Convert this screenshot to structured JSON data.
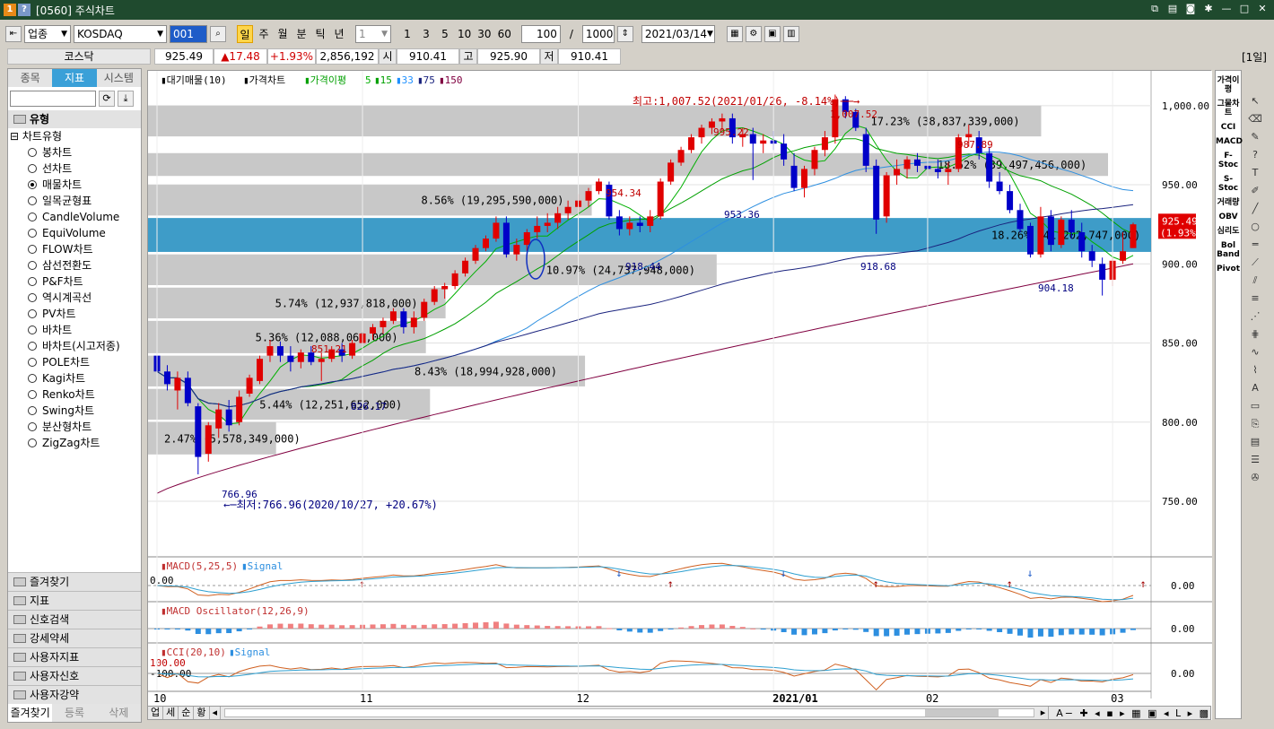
{
  "window": {
    "title": "[0560] 주식차트",
    "badge_a": "1",
    "badge_b": "?"
  },
  "toolbar": {
    "market_type": "업종",
    "market_name": "KOSDAQ",
    "code": "001",
    "periods": [
      "일",
      "주",
      "월",
      "분",
      "틱",
      "년"
    ],
    "active_period": "일",
    "interval": "1",
    "quick_counts": [
      "1",
      "3",
      "5",
      "10",
      "30",
      "60"
    ],
    "display_count": "100",
    "slash": "/",
    "total_count": "1000",
    "date": "2021/03/14"
  },
  "pricebar": {
    "name": "코스닥",
    "close": "925.49",
    "change": "▲17.48",
    "change_pct": "+1.93%",
    "volume": "2,856,192",
    "open_label": "시",
    "open": "910.41",
    "high_label": "고",
    "high": "925.90",
    "low_label": "저",
    "low": "910.41",
    "period_badge": "[1일]"
  },
  "left_panel": {
    "tabs": [
      "종목",
      "지표",
      "시스템"
    ],
    "active_tab": "지표",
    "category": "유형",
    "subcategory": "차트유형",
    "options": [
      "봉차트",
      "선차트",
      "매물차트",
      "일목균형표",
      "CandleVolume",
      "EquiVolume",
      "FLOW차트",
      "삼선전환도",
      "P&F차트",
      "역시계곡선",
      "PV차트",
      "바차트",
      "바차트(시고저종)",
      "POLE차트",
      "Kagi차트",
      "Renko차트",
      "Swing차트",
      "분산형차트",
      "ZigZag차트"
    ],
    "selected_option": "매물차트",
    "bottom_categories": [
      "즐겨찾기",
      "지표",
      "신호검색",
      "강세약세",
      "사용자지표",
      "사용자신호",
      "사용자강약"
    ],
    "bottom_tabs": [
      "즐겨찾기",
      "등록",
      "삭제"
    ]
  },
  "right_panel": {
    "items": [
      "가격이평",
      "그물차트",
      "CCI",
      "MACD",
      "F-Stoc",
      "S-Stoc",
      "거래량",
      "OBV",
      "심리도",
      "Bol Band",
      "Pivot"
    ]
  },
  "scrollbar": {
    "tabs": [
      "업",
      "세",
      "순",
      "황"
    ]
  },
  "chart_data": {
    "type": "candlestick",
    "legend": [
      "대기매물(10)",
      "가격차트",
      "가격이평",
      "5",
      "15",
      "33",
      "75",
      "150"
    ],
    "legend_colors": [
      "#000000",
      "#000000",
      "#00a000",
      "#00c000",
      "#00a000",
      "#1e90ff",
      "#1a237e",
      "#800040"
    ],
    "y_ticks": [
      1000,
      950,
      900,
      850,
      800,
      750
    ],
    "y_tick_labels": [
      "1,000.00",
      "950.00",
      "900.00",
      "850.00",
      "800.00",
      "750.00"
    ],
    "ylim": [
      716,
      1022
    ],
    "x_labels": [
      "10",
      "11",
      "12",
      "2021/01",
      "02",
      "03"
    ],
    "current_price": "925.49",
    "current_change": "(1.93%)",
    "annotations": {
      "high": "최고:1,007.52(2021/01/26, -8.14%)",
      "low": "최저:766.96(2020/10/27, +20.67%)",
      "points": [
        {
          "text": "1,007.52",
          "color": "#c00000"
        },
        {
          "text": "995.22",
          "color": "#c00000"
        },
        {
          "text": "987.89",
          "color": "#c00000"
        },
        {
          "text": "954.34",
          "color": "#c00000"
        },
        {
          "text": "851.21",
          "color": "#c00000"
        },
        {
          "text": "953.36",
          "color": "#000080"
        },
        {
          "text": "918.44",
          "color": "#000080"
        },
        {
          "text": "918.68",
          "color": "#000080"
        },
        {
          "text": "904.18",
          "color": "#000080"
        },
        {
          "text": "826.17",
          "color": "#000080"
        },
        {
          "text": "766.96",
          "color": "#000080"
        }
      ]
    },
    "volume_profile": [
      {
        "label": "17.23% (38,837,339,000)",
        "low": 980,
        "high": 1000
      },
      {
        "label": "18.52% (39,497,456,000)",
        "low": 955,
        "high": 970
      },
      {
        "label": "8.56% (19,295,590,000)",
        "low": 930,
        "high": 950
      },
      {
        "label": "18.26% (41,202,747,000)",
        "low": 907,
        "high": 929
      },
      {
        "label": "10.97% (24,737,948,000)",
        "low": 886,
        "high": 906
      },
      {
        "label": "5.74% (12,937,818,000)",
        "low": 865,
        "high": 885
      },
      {
        "label": "5.36% (12,088,068,000)",
        "low": 843,
        "high": 864
      },
      {
        "label": "8.43% (18,994,928,000)",
        "low": 822,
        "high": 842
      },
      {
        "label": "5.44% (12,251,652,000)",
        "low": 801,
        "high": 821
      },
      {
        "label": "2.47% (5,578,349,000)",
        "low": 779,
        "high": 800
      }
    ],
    "candles": [
      {
        "d": "2020-10-21",
        "o": 842,
        "h": 845,
        "l": 830,
        "c": 832
      },
      {
        "d": "2020-10-22",
        "o": 832,
        "h": 836,
        "l": 820,
        "c": 824
      },
      {
        "d": "2020-10-23",
        "o": 820,
        "h": 832,
        "l": 808,
        "c": 828
      },
      {
        "d": "2020-10-26",
        "o": 828,
        "h": 832,
        "l": 810,
        "c": 812
      },
      {
        "d": "2020-10-27",
        "o": 810,
        "h": 812,
        "l": 767,
        "c": 778
      },
      {
        "d": "2020-10-28",
        "o": 780,
        "h": 800,
        "l": 775,
        "c": 798
      },
      {
        "d": "2020-10-29",
        "o": 796,
        "h": 812,
        "l": 790,
        "c": 808
      },
      {
        "d": "2020-10-30",
        "o": 808,
        "h": 814,
        "l": 794,
        "c": 798
      },
      {
        "d": "2020-11-02",
        "o": 800,
        "h": 820,
        "l": 798,
        "c": 816
      },
      {
        "d": "2020-11-03",
        "o": 818,
        "h": 830,
        "l": 816,
        "c": 828
      },
      {
        "d": "2020-11-04",
        "o": 826,
        "h": 842,
        "l": 824,
        "c": 840
      },
      {
        "d": "2020-11-05",
        "o": 842,
        "h": 852,
        "l": 838,
        "c": 848
      },
      {
        "d": "2020-11-06",
        "o": 848,
        "h": 851,
        "l": 838,
        "c": 842
      },
      {
        "d": "2020-11-09",
        "o": 842,
        "h": 848,
        "l": 832,
        "c": 838
      },
      {
        "d": "2020-11-10",
        "o": 838,
        "h": 846,
        "l": 834,
        "c": 844
      },
      {
        "d": "2020-11-11",
        "o": 844,
        "h": 848,
        "l": 836,
        "c": 838
      },
      {
        "d": "2020-11-12",
        "o": 838,
        "h": 844,
        "l": 826,
        "c": 840
      },
      {
        "d": "2020-11-13",
        "o": 840,
        "h": 848,
        "l": 838,
        "c": 846
      },
      {
        "d": "2020-11-16",
        "o": 846,
        "h": 850,
        "l": 838,
        "c": 842
      },
      {
        "d": "2020-11-17",
        "o": 842,
        "h": 852,
        "l": 840,
        "c": 850
      },
      {
        "d": "2020-11-18",
        "o": 850,
        "h": 858,
        "l": 848,
        "c": 856
      },
      {
        "d": "2020-11-19",
        "o": 856,
        "h": 862,
        "l": 852,
        "c": 860
      },
      {
        "d": "2020-11-20",
        "o": 860,
        "h": 866,
        "l": 856,
        "c": 864
      },
      {
        "d": "2020-11-23",
        "o": 864,
        "h": 872,
        "l": 862,
        "c": 870
      },
      {
        "d": "2020-11-24",
        "o": 870,
        "h": 872,
        "l": 856,
        "c": 860
      },
      {
        "d": "2020-11-25",
        "o": 860,
        "h": 870,
        "l": 856,
        "c": 866
      },
      {
        "d": "2020-11-26",
        "o": 866,
        "h": 878,
        "l": 864,
        "c": 876
      },
      {
        "d": "2020-11-27",
        "o": 876,
        "h": 886,
        "l": 874,
        "c": 884
      },
      {
        "d": "2020-11-30",
        "o": 884,
        "h": 888,
        "l": 878,
        "c": 886
      },
      {
        "d": "2020-12-01",
        "o": 886,
        "h": 896,
        "l": 884,
        "c": 894
      },
      {
        "d": "2020-12-02",
        "o": 894,
        "h": 904,
        "l": 892,
        "c": 902
      },
      {
        "d": "2020-12-03",
        "o": 902,
        "h": 912,
        "l": 900,
        "c": 910
      },
      {
        "d": "2020-12-04",
        "o": 910,
        "h": 918,
        "l": 908,
        "c": 916
      },
      {
        "d": "2020-12-07",
        "o": 916,
        "h": 930,
        "l": 914,
        "c": 926
      },
      {
        "d": "2020-12-08",
        "o": 926,
        "h": 930,
        "l": 904,
        "c": 906
      },
      {
        "d": "2020-12-09",
        "o": 906,
        "h": 916,
        "l": 902,
        "c": 912
      },
      {
        "d": "2020-12-10",
        "o": 912,
        "h": 922,
        "l": 908,
        "c": 920
      },
      {
        "d": "2020-12-11",
        "o": 920,
        "h": 930,
        "l": 916,
        "c": 924
      },
      {
        "d": "2020-12-14",
        "o": 924,
        "h": 932,
        "l": 920,
        "c": 926
      },
      {
        "d": "2020-12-15",
        "o": 926,
        "h": 936,
        "l": 922,
        "c": 932
      },
      {
        "d": "2020-12-16",
        "o": 932,
        "h": 940,
        "l": 928,
        "c": 936
      },
      {
        "d": "2020-12-17",
        "o": 936,
        "h": 944,
        "l": 932,
        "c": 940
      },
      {
        "d": "2020-12-18",
        "o": 940,
        "h": 948,
        "l": 936,
        "c": 946
      },
      {
        "d": "2020-12-21",
        "o": 946,
        "h": 954,
        "l": 944,
        "c": 952
      },
      {
        "d": "2020-12-22",
        "o": 950,
        "h": 952,
        "l": 928,
        "c": 930
      },
      {
        "d": "2020-12-23",
        "o": 930,
        "h": 934,
        "l": 918,
        "c": 922
      },
      {
        "d": "2020-12-24",
        "o": 922,
        "h": 930,
        "l": 918,
        "c": 926
      },
      {
        "d": "2020-12-28",
        "o": 926,
        "h": 930,
        "l": 920,
        "c": 924
      },
      {
        "d": "2020-12-29",
        "o": 924,
        "h": 934,
        "l": 920,
        "c": 930
      },
      {
        "d": "2020-12-30",
        "o": 930,
        "h": 954,
        "l": 928,
        "c": 952
      },
      {
        "d": "2021-01-04",
        "o": 952,
        "h": 966,
        "l": 950,
        "c": 964
      },
      {
        "d": "2021-01-05",
        "o": 964,
        "h": 974,
        "l": 962,
        "c": 972
      },
      {
        "d": "2021-01-06",
        "o": 972,
        "h": 982,
        "l": 970,
        "c": 980
      },
      {
        "d": "2021-01-07",
        "o": 980,
        "h": 988,
        "l": 976,
        "c": 986
      },
      {
        "d": "2021-01-08",
        "o": 986,
        "h": 992,
        "l": 982,
        "c": 990
      },
      {
        "d": "2021-01-11",
        "o": 990,
        "h": 995,
        "l": 984,
        "c": 992
      },
      {
        "d": "2021-01-12",
        "o": 992,
        "h": 995,
        "l": 976,
        "c": 980
      },
      {
        "d": "2021-01-13",
        "o": 980,
        "h": 986,
        "l": 974,
        "c": 982
      },
      {
        "d": "2021-01-14",
        "o": 982,
        "h": 986,
        "l": 953,
        "c": 976
      },
      {
        "d": "2021-01-15",
        "o": 976,
        "h": 982,
        "l": 970,
        "c": 978
      },
      {
        "d": "2021-01-18",
        "o": 978,
        "h": 984,
        "l": 972,
        "c": 976
      },
      {
        "d": "2021-01-19",
        "o": 976,
        "h": 982,
        "l": 962,
        "c": 966
      },
      {
        "d": "2021-01-20",
        "o": 962,
        "h": 970,
        "l": 946,
        "c": 948
      },
      {
        "d": "2021-01-21",
        "o": 948,
        "h": 962,
        "l": 942,
        "c": 960
      },
      {
        "d": "2021-01-22",
        "o": 960,
        "h": 974,
        "l": 956,
        "c": 972
      },
      {
        "d": "2021-01-25",
        "o": 972,
        "h": 984,
        "l": 968,
        "c": 980
      },
      {
        "d": "2021-01-26",
        "o": 980,
        "h": 1007,
        "l": 976,
        "c": 1004
      },
      {
        "d": "2021-01-27",
        "o": 1004,
        "h": 1006,
        "l": 992,
        "c": 996
      },
      {
        "d": "2021-01-28",
        "o": 996,
        "h": 998,
        "l": 984,
        "c": 986
      },
      {
        "d": "2021-01-29",
        "o": 982,
        "h": 986,
        "l": 958,
        "c": 962
      },
      {
        "d": "2021-02-01",
        "o": 962,
        "h": 966,
        "l": 919,
        "c": 928
      },
      {
        "d": "2021-02-02",
        "o": 930,
        "h": 958,
        "l": 926,
        "c": 956
      },
      {
        "d": "2021-02-03",
        "o": 956,
        "h": 966,
        "l": 950,
        "c": 960
      },
      {
        "d": "2021-02-04",
        "o": 960,
        "h": 968,
        "l": 954,
        "c": 966
      },
      {
        "d": "2021-02-05",
        "o": 966,
        "h": 970,
        "l": 958,
        "c": 962
      },
      {
        "d": "2021-02-08",
        "o": 962,
        "h": 968,
        "l": 956,
        "c": 960
      },
      {
        "d": "2021-02-09",
        "o": 960,
        "h": 966,
        "l": 954,
        "c": 958
      },
      {
        "d": "2021-02-10",
        "o": 958,
        "h": 964,
        "l": 950,
        "c": 960
      },
      {
        "d": "2021-02-15",
        "o": 960,
        "h": 982,
        "l": 958,
        "c": 980
      },
      {
        "d": "2021-02-16",
        "o": 980,
        "h": 988,
        "l": 974,
        "c": 982
      },
      {
        "d": "2021-02-17",
        "o": 980,
        "h": 984,
        "l": 966,
        "c": 970
      },
      {
        "d": "2021-02-18",
        "o": 970,
        "h": 974,
        "l": 948,
        "c": 952
      },
      {
        "d": "2021-02-19",
        "o": 952,
        "h": 958,
        "l": 944,
        "c": 946
      },
      {
        "d": "2021-02-22",
        "o": 946,
        "h": 950,
        "l": 932,
        "c": 934
      },
      {
        "d": "2021-02-23",
        "o": 934,
        "h": 938,
        "l": 920,
        "c": 922
      },
      {
        "d": "2021-02-24",
        "o": 924,
        "h": 926,
        "l": 904,
        "c": 906
      },
      {
        "d": "2021-02-25",
        "o": 906,
        "h": 936,
        "l": 904,
        "c": 930
      },
      {
        "d": "2021-02-26",
        "o": 930,
        "h": 934,
        "l": 908,
        "c": 912
      },
      {
        "d": "2021-03-02",
        "o": 912,
        "h": 930,
        "l": 910,
        "c": 928
      },
      {
        "d": "2021-03-03",
        "o": 928,
        "h": 934,
        "l": 916,
        "c": 920
      },
      {
        "d": "2021-03-04",
        "o": 920,
        "h": 926,
        "l": 904,
        "c": 908
      },
      {
        "d": "2021-03-05",
        "o": 908,
        "h": 912,
        "l": 898,
        "c": 902
      },
      {
        "d": "2021-03-08",
        "o": 900,
        "h": 904,
        "l": 880,
        "c": 890
      },
      {
        "d": "2021-03-09",
        "o": 890,
        "h": 904,
        "l": 886,
        "c": 902
      },
      {
        "d": "2021-03-10",
        "o": 902,
        "h": 920,
        "l": 900,
        "c": 908
      },
      {
        "d": "2021-03-11",
        "o": 910,
        "h": 926,
        "l": 910,
        "c": 925
      }
    ],
    "sub_panels": [
      {
        "name": "MACD(5,25,5)",
        "signal": "Signal",
        "zero_label": "0.00",
        "ref_label": "0.00"
      },
      {
        "name": "MACD Oscillator(12,26,9)",
        "ref_label": "0.00"
      },
      {
        "name": "CCI(20,10)",
        "signal": "Signal",
        "upper_label": "100.00",
        "lower_label": "-100.00",
        "ref_label": "0.00"
      }
    ]
  }
}
